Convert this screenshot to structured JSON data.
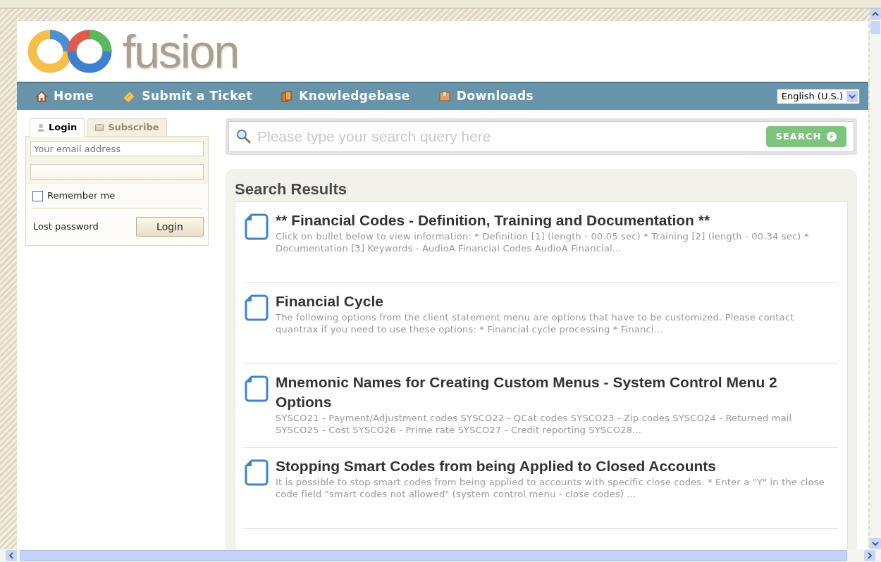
{
  "logo": {
    "text": "fusion"
  },
  "nav": {
    "items": [
      {
        "label": "Home",
        "kind": "home"
      },
      {
        "label": "Submit a Ticket",
        "kind": "ticket"
      },
      {
        "label": "Knowledgebase",
        "kind": "book"
      },
      {
        "label": "Downloads",
        "kind": "box"
      }
    ],
    "language": "English (U.S.)"
  },
  "login": {
    "tabs": [
      {
        "label": "Login",
        "selected": true
      },
      {
        "label": "Subscribe",
        "selected": false
      }
    ],
    "email_placeholder": "Your email address",
    "remember": {
      "label": "Remember me",
      "checked": false
    },
    "lost_password": "Lost password",
    "button": "Login"
  },
  "search": {
    "placeholder": "Please type your search query here",
    "button": "SEARCH"
  },
  "results": {
    "title": "Search Results",
    "items": [
      {
        "title": "** Financial Codes - Definition, Training and Documentation **",
        "snippet": "Click on bullet below to view information: * Definition [1] (length - 00.05 sec) * Training [2] (length - 00.34 sec) * Documentation [3] Keywords - AudioA Financial Codes AudioA Financial..."
      },
      {
        "title": "Financial Cycle",
        "snippet": "The following options from the client statement menu are options that have to be customized. Please contact quantrax if you need to use these options: * Financial cycle processing * Financi..."
      },
      {
        "title": "Mnemonic Names for Creating Custom Menus - System Control Menu 2 Options",
        "snippet": "SYSCO21 - Payment/Adjustment codes SYSCO22 - QCat codes SYSCO23 - Zip codes SYSCO24 - Returned mail SYSCO25 - Cost SYSCO26 - Prime rate SYSCO27 - Credit reporting SYSCO28..."
      },
      {
        "title": "Stopping Smart Codes from being Applied to Closed Accounts",
        "snippet": "It is possible to stop smart codes from being applied to accounts with specific close codes. * Enter a \"Y\" in the close code field \"smart codes not allowed\" (system control menu - close codes) ..."
      }
    ]
  }
}
